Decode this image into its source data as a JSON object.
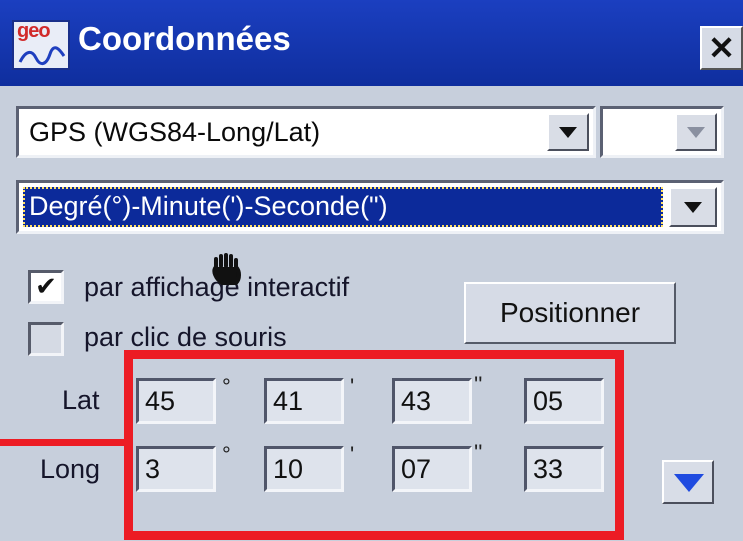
{
  "window": {
    "title": "Coordonnées",
    "logo_text": "geo"
  },
  "system": {
    "selected": "GPS (WGS84-Long/Lat)"
  },
  "format": {
    "selected": "Degré(°)-Minute(')-Seconde(\")"
  },
  "options": {
    "interactive_label": "par affichage interactif",
    "interactive_checked": "✔",
    "click_label": "par clic de souris",
    "position_button": "Positionner"
  },
  "coords": {
    "lat": {
      "label": "Lat",
      "deg": "45",
      "min": "41",
      "sec": "43",
      "hundredths": "05"
    },
    "long": {
      "label": "Long",
      "deg": "3",
      "min": "10",
      "sec": "07",
      "hundredths": "33"
    },
    "units": {
      "deg": "°",
      "min": "'",
      "sec": "''"
    }
  },
  "colors": {
    "titlebar": "#1b3fc0",
    "selection": "#0c2a9a",
    "highlight": "#ec1c24"
  }
}
